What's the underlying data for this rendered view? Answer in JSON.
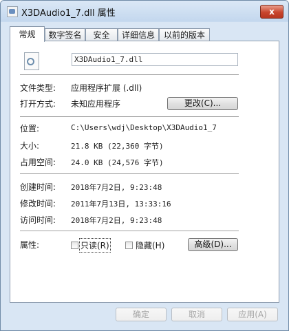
{
  "window": {
    "title": "X3DAudio1_7.dll 属性",
    "close_label": "x"
  },
  "tabs": [
    {
      "label": "常规"
    },
    {
      "label": "数字签名"
    },
    {
      "label": "安全"
    },
    {
      "label": "详细信息"
    },
    {
      "label": "以前的版本"
    }
  ],
  "general": {
    "file_name": "X3DAudio1_7.dll",
    "file_type_label": "文件类型:",
    "file_type_value": "应用程序扩展 (.dll)",
    "open_with_label": "打开方式:",
    "open_with_value": "未知应用程序",
    "change_button": "更改(C)...",
    "location_label": "位置:",
    "location_value": "C:\\Users\\wdj\\Desktop\\X3DAudio1_7",
    "size_label": "大小:",
    "size_value": "21.8 KB (22,360 字节)",
    "size_on_disk_label": "占用空间:",
    "size_on_disk_value": "24.0 KB (24,576 字节)",
    "created_label": "创建时间:",
    "created_value": "2018年7月2日, 9:23:48",
    "modified_label": "修改时间:",
    "modified_value": "2011年7月13日, 13:33:16",
    "accessed_label": "访问时间:",
    "accessed_value": "2018年7月2日, 9:23:48",
    "attributes_label": "属性:",
    "readonly_label": "只读(R)",
    "hidden_label": "隐藏(H)",
    "advanced_button": "高级(D)..."
  },
  "footer": {
    "ok": "确定",
    "cancel": "取消",
    "apply": "应用(A)"
  }
}
